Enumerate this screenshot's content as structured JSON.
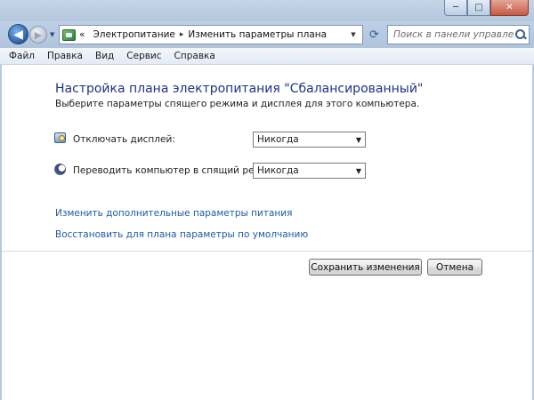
{
  "window": {
    "controls": {
      "minimize": "─",
      "maximize": "□",
      "close": "✕"
    }
  },
  "navigation": {
    "back_icon": "◀",
    "forward_icon": "▶",
    "breadcrumb_prefix": "«",
    "breadcrumbs": [
      "Электропитание",
      "Изменить параметры плана"
    ],
    "breadcrumb_separator": "▸",
    "search_placeholder": "Поиск в панели управления"
  },
  "menu": [
    "Файл",
    "Правка",
    "Вид",
    "Сервис",
    "Справка"
  ],
  "content": {
    "heading": "Настройка плана электропитания \"Сбалансированный\"",
    "subheading": "Выберите параметры спящего режима и дисплея для этого компьютера.",
    "settings": [
      {
        "label": "Отключать дисплей:",
        "value": "Никогда",
        "icon": "display-icon"
      },
      {
        "label": "Переводить компьютер в спящий режим:",
        "value": "Никогда",
        "icon": "sleep-icon"
      }
    ],
    "links": [
      "Изменить дополнительные параметры питания",
      "Восстановить для плана параметры по умолчанию"
    ]
  },
  "buttons": {
    "save": "Сохранить изменения",
    "cancel": "Отмена"
  },
  "colors": {
    "heading": "#1e3287",
    "link": "#1f5aa8",
    "chrome": "#b6c9e0"
  }
}
